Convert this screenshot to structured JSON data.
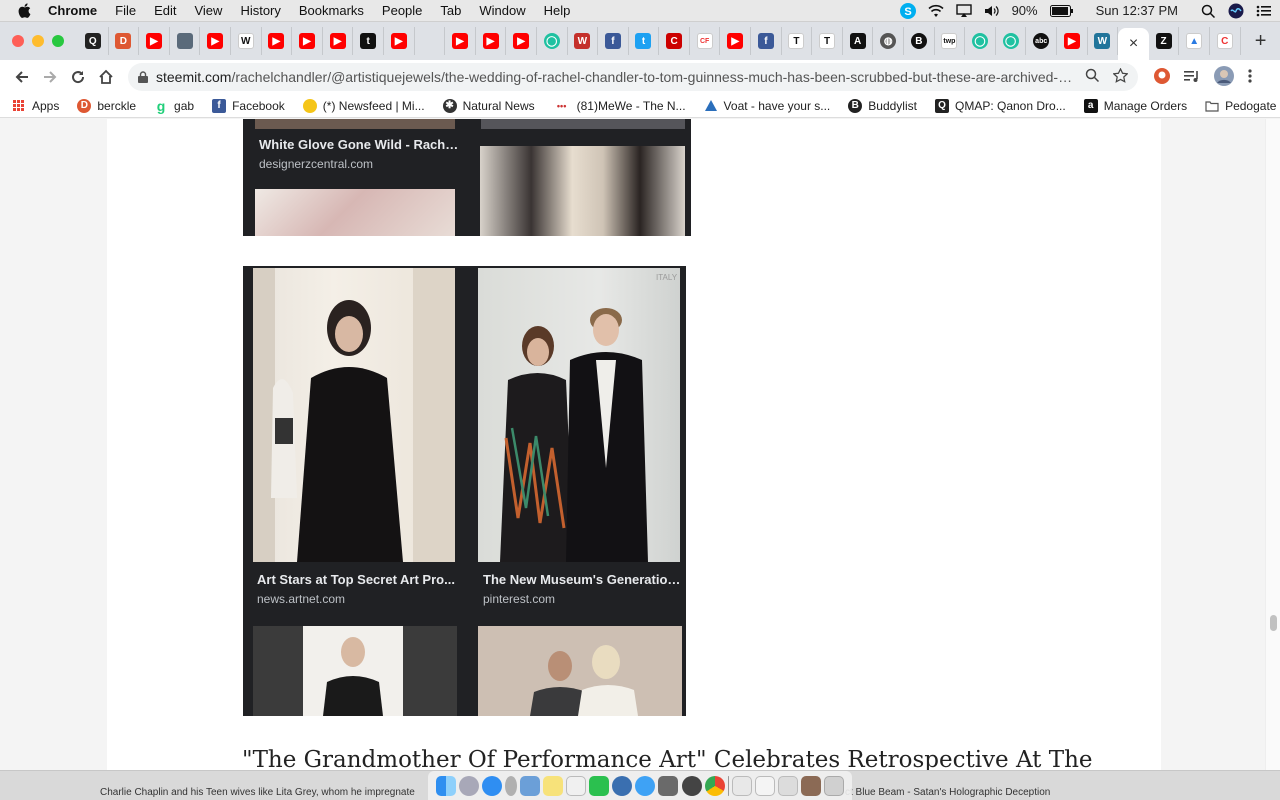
{
  "menubar": {
    "app_name": "Chrome",
    "items": [
      "File",
      "Edit",
      "View",
      "History",
      "Bookmarks",
      "People",
      "Tab",
      "Window",
      "Help"
    ],
    "battery": "90%",
    "clock": "Sun 12:37 PM"
  },
  "tabs": {
    "favicons": [
      "q-icon",
      "duckduckgo-icon",
      "youtube-icon",
      "photo-icon",
      "youtube-icon",
      "wikipedia-icon",
      "youtube-icon",
      "youtube-icon",
      "youtube-icon",
      "t-icon",
      "youtube-icon",
      "blank-icon",
      "youtube-icon",
      "youtube-icon",
      "youtube-icon",
      "green-circle-icon",
      "w-icon",
      "facebook-icon",
      "twitter-icon",
      "cnn-icon",
      "cf-icon",
      "youtube-icon",
      "facebook-icon",
      "nyt-icon",
      "nyt-icon",
      "atlantic-icon",
      "globe-icon",
      "b-icon",
      "twp-icon",
      "green-circle-icon",
      "green-circle-icon",
      "abc-icon",
      "youtube-icon",
      "wordpress-icon"
    ],
    "active_close": "×",
    "after_active": [
      "z-icon",
      "triangle-icon",
      "c-icon"
    ],
    "new_tab": "+"
  },
  "toolbar": {
    "url_domain": "steemit.com",
    "url_path": "/rachelchandler/@artistiquejewels/the-wedding-of-rachel-chandler-to-tom-guinness-much-has-been-scrubbed-but-these-are-archived-what..."
  },
  "bookmarks": [
    {
      "label": "Apps",
      "icon": "apps-grid-icon",
      "color": "#4285f4"
    },
    {
      "label": "berckle",
      "icon": "duckduckgo-icon",
      "color": "#de5833"
    },
    {
      "label": "gab",
      "icon": "gab-icon",
      "color": "#21cf7a"
    },
    {
      "label": "Facebook",
      "icon": "facebook-icon",
      "color": "#3b5998"
    },
    {
      "label": "(*) Newsfeed | Mi...",
      "icon": "bulb-icon",
      "color": "#f5c518"
    },
    {
      "label": "Natural News",
      "icon": "natural-news-icon",
      "color": "#333333"
    },
    {
      "label": "(81)MeWe - The N...",
      "icon": "dots-icon",
      "color": "#cc3333"
    },
    {
      "label": "Voat - have your s...",
      "icon": "voat-icon",
      "color": "#2a6ebb"
    },
    {
      "label": "Buddylist",
      "icon": "b-circle-icon",
      "color": "#222222"
    },
    {
      "label": "QMAP: Qanon Dro...",
      "icon": "q-icon",
      "color": "#222222"
    },
    {
      "label": "Manage Orders",
      "icon": "amazon-icon",
      "color": "#111111"
    },
    {
      "label": "Pedogate",
      "icon": "folder-icon",
      "color": "#666666"
    }
  ],
  "content": {
    "top_block": {
      "caption_title": "White Glove Gone Wild - Rachel...",
      "caption_src": "designerzcentral.com"
    },
    "main_block": {
      "left_title": "Art Stars at Top Secret Art Pro...",
      "left_src": "news.artnet.com",
      "right_title": "The New Museum's Generation ...",
      "right_src": "pinterest.com",
      "watermark": "ITALY"
    },
    "heading": "\"The Grandmother Of Performance Art\" Celebrates Retrospective At The"
  },
  "dock": {
    "left_text": "Charlie Chaplin and his Teen wives like Lita Grey, whom he impregnate",
    "right_text": "ct Blue Beam - Satan's Holographic Deception"
  }
}
